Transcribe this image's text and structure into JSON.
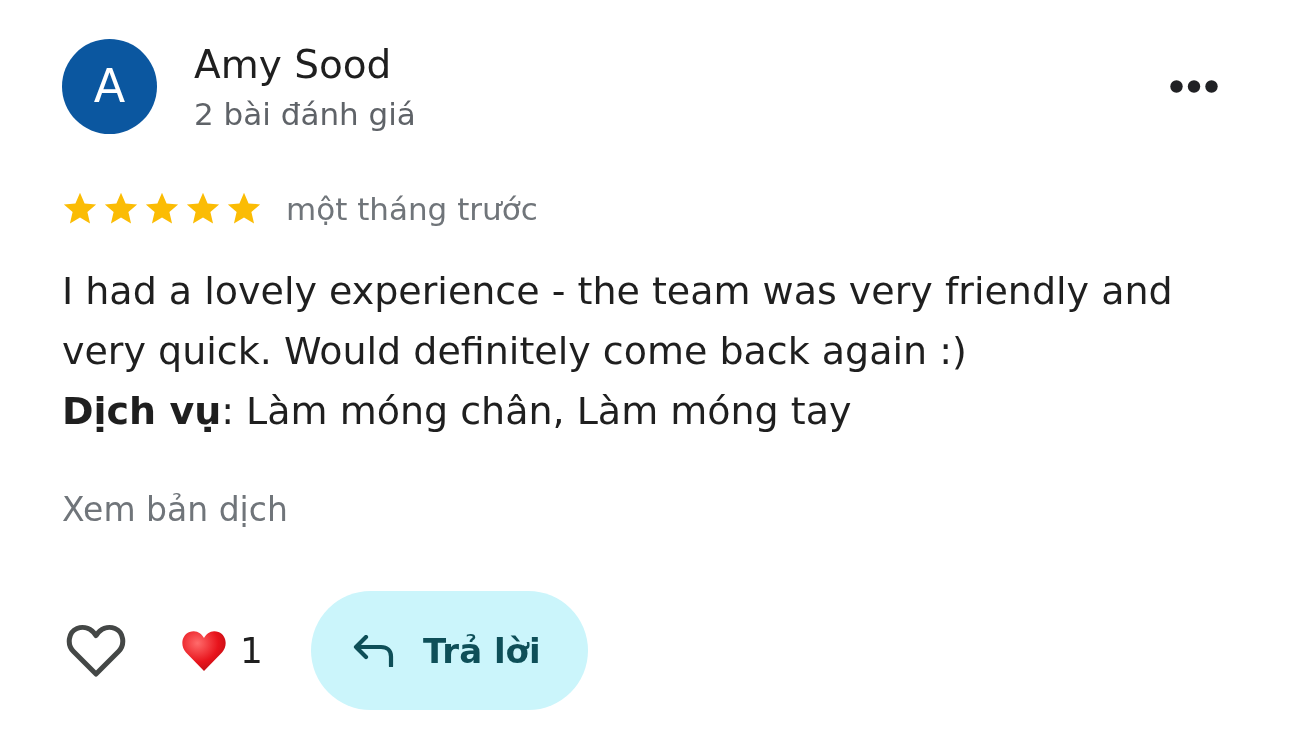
{
  "review": {
    "author": {
      "initial": "A",
      "name": "Amy Sood",
      "review_count": "2 bài đánh giá"
    },
    "stars": 5,
    "time": "một tháng trước",
    "text": "I had a lovely experience - the team was very friendly and very quick. Would definitely come back again :)",
    "services": "**Dịch vụ**: Làm móng chân, Làm móng tay",
    "translate_link": "Xem bản dịch",
    "reactions": {
      "count": "1"
    },
    "reply_button": "Trả lời"
  }
}
